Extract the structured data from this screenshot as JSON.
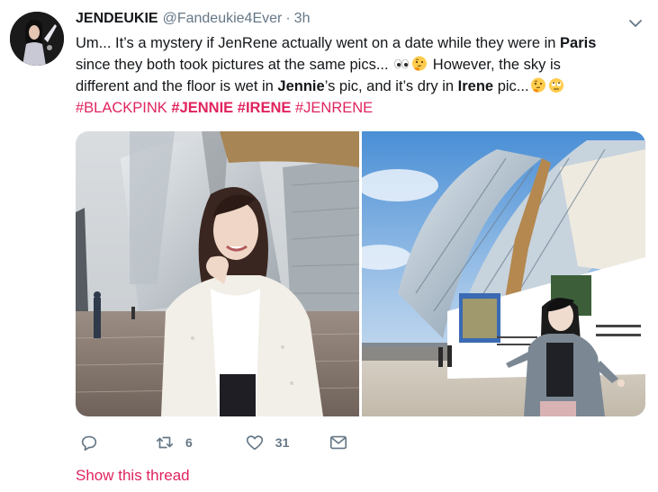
{
  "tweet": {
    "display_name": "JENDEUKIE",
    "handle": "@Fandeukie4Ever",
    "separator": "·",
    "time": "3h",
    "text": {
      "l1_a": "Um... It’s a mystery if JenRene actually went on a date while they were in ",
      "l1_b": "Paris",
      "l2_a": "since they both took pictures at the same pics... ",
      "l2_b": " However, the sky is",
      "l3_a": "different and the floor is wet in ",
      "l3_b": "Jennie",
      "l3_c": "’s pic, and it’s dry in ",
      "l3_d": "Irene",
      "l3_e": " pic..."
    },
    "hashtags": {
      "h1": "#BLACKPINK",
      "h2": "#JENNIE",
      "h3": "#IRENE",
      "h4": "#JENRENE"
    },
    "emojis": [
      "eyes-emoji",
      "thinking-face-emoji",
      "thinking-face-emoji",
      "face-with-rolling-eyes-emoji"
    ],
    "actions": {
      "reply_count": "",
      "retweet_count": "6",
      "like_count": "31"
    },
    "show_thread": "Show this thread"
  },
  "colors": {
    "hashtag": "#e0245e",
    "secondary_text": "#657786",
    "primary_text": "#14171a"
  },
  "icons": [
    "caret-down-icon",
    "reply-icon",
    "retweet-icon",
    "heart-icon",
    "direct-message-icon"
  ]
}
